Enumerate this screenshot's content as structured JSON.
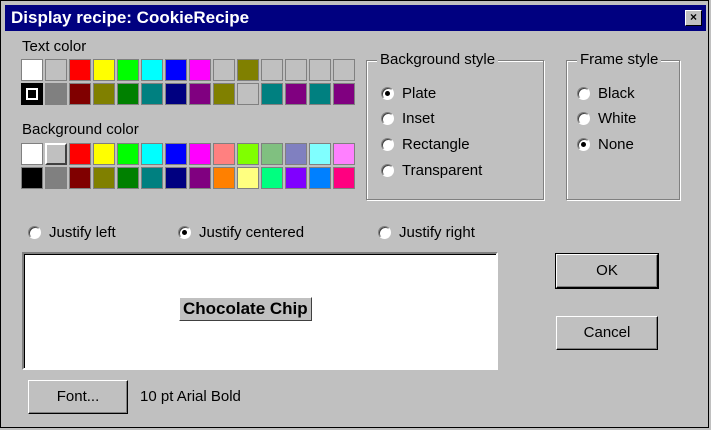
{
  "window": {
    "title": "Display recipe: CookieRecipe",
    "close_symbol": "×"
  },
  "text_color": {
    "label": "Text color",
    "rows": [
      [
        "#ffffff",
        "#c0c0c0",
        "#ff0000",
        "#ffff00",
        "#00ff00",
        "#00ffff",
        "#0000ff",
        "#ff00ff",
        "#c0c0c0",
        "#808000",
        "#c0c0c0",
        "#c0c0c0",
        "#c0c0c0",
        "#c0c0c0"
      ],
      [
        "#000000",
        "#808080",
        "#800000",
        "#808000",
        "#008000",
        "#008080",
        "#000080",
        "#800080",
        "#808000",
        "#c0c0c0",
        "#008080",
        "#800080",
        "#008080",
        "#800080"
      ]
    ],
    "selected": "#000000"
  },
  "background_color": {
    "label": "Background color",
    "rows": [
      [
        "#ffffff",
        "#c0c0c0",
        "#ff0000",
        "#ffff00",
        "#00ff00",
        "#00ffff",
        "#0000ff",
        "#ff00ff",
        "#ff8080",
        "#80ff00",
        "#80c080",
        "#8080c0",
        "#80ffff",
        "#ff80ff"
      ],
      [
        "#000000",
        "#808080",
        "#800000",
        "#808000",
        "#008000",
        "#008080",
        "#000080",
        "#800080",
        "#ff8000",
        "#ffff80",
        "#00ff80",
        "#8000ff",
        "#0080ff",
        "#ff0080"
      ]
    ],
    "dithered_from_index": 8,
    "selected": "#c0c0c0"
  },
  "background_style": {
    "title": "Background style",
    "options": [
      {
        "label": "Plate",
        "selected": true
      },
      {
        "label": "Inset",
        "selected": false
      },
      {
        "label": "Rectangle",
        "selected": false
      },
      {
        "label": "Transparent",
        "selected": false
      }
    ]
  },
  "frame_style": {
    "title": "Frame style",
    "options": [
      {
        "label": "Black",
        "selected": false
      },
      {
        "label": "White",
        "selected": false
      },
      {
        "label": "None",
        "selected": true
      }
    ]
  },
  "justify": {
    "left": "Justify left",
    "centered": "Justify centered",
    "right": "Justify right",
    "selected": "centered"
  },
  "preview": {
    "text": "Chocolate Chip"
  },
  "buttons": {
    "ok": "OK",
    "cancel": "Cancel",
    "font": "Font..."
  },
  "font_description": "10 pt Arial Bold"
}
